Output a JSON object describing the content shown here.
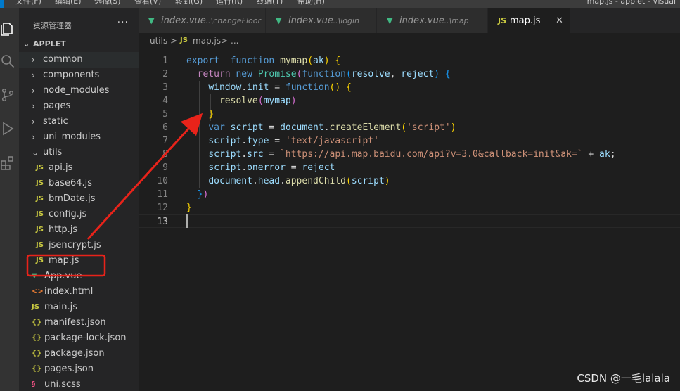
{
  "menu": {
    "items": [
      "文件(F)",
      "编辑(E)",
      "选择(S)",
      "查看(V)",
      "转到(G)",
      "运行(R)",
      "终端(T)",
      "帮助(H)"
    ],
    "window_title": "map.js - applet - Visual"
  },
  "activity_bar": {
    "icons": [
      "explorer-icon",
      "search-icon",
      "source-control-icon",
      "run-debug-icon",
      "extensions-icon"
    ]
  },
  "sidebar": {
    "title": "资源管理器",
    "more": "···",
    "section": "APPLET",
    "tree": [
      {
        "name": "common",
        "type": "folder",
        "expanded": false,
        "depth": 1
      },
      {
        "name": "components",
        "type": "folder",
        "expanded": false,
        "depth": 1
      },
      {
        "name": "node_modules",
        "type": "folder",
        "expanded": false,
        "depth": 1
      },
      {
        "name": "pages",
        "type": "folder",
        "expanded": false,
        "depth": 1
      },
      {
        "name": "static",
        "type": "folder",
        "expanded": false,
        "depth": 1
      },
      {
        "name": "uni_modules",
        "type": "folder",
        "expanded": false,
        "depth": 1
      },
      {
        "name": "utils",
        "type": "folder",
        "expanded": true,
        "depth": 1
      },
      {
        "name": "api.js",
        "type": "js",
        "depth": 2,
        "icon_text": "JS"
      },
      {
        "name": "base64.js",
        "type": "js",
        "depth": 2,
        "icon_text": "JS"
      },
      {
        "name": "bmDate.js",
        "type": "js",
        "depth": 2,
        "icon_text": "JS"
      },
      {
        "name": "config.js",
        "type": "js",
        "depth": 2,
        "icon_text": "JS"
      },
      {
        "name": "http.js",
        "type": "js",
        "depth": 2,
        "icon_text": "JS"
      },
      {
        "name": "jsencrypt.js",
        "type": "js",
        "depth": 2,
        "icon_text": "JS"
      },
      {
        "name": "map.js",
        "type": "js",
        "depth": 2,
        "icon_text": "JS"
      },
      {
        "name": "App.vue",
        "type": "vue",
        "depth": 1,
        "icon_text": "▼"
      },
      {
        "name": "index.html",
        "type": "html",
        "depth": 1,
        "icon_text": "<>"
      },
      {
        "name": "main.js",
        "type": "js",
        "depth": 1,
        "icon_text": "JS"
      },
      {
        "name": "manifest.json",
        "type": "json",
        "depth": 1,
        "icon_text": "{}"
      },
      {
        "name": "package-lock.json",
        "type": "json",
        "depth": 1,
        "icon_text": "{}"
      },
      {
        "name": "package.json",
        "type": "json",
        "depth": 1,
        "icon_text": "{}"
      },
      {
        "name": "pages.json",
        "type": "json",
        "depth": 1,
        "icon_text": "{}"
      },
      {
        "name": "uni.scss",
        "type": "scss",
        "depth": 1,
        "icon_text": "§"
      }
    ]
  },
  "tabs": [
    {
      "name": "index.vue",
      "dir": "...\\changeFloor",
      "type": "vue",
      "icon_text": "▼",
      "active": false
    },
    {
      "name": "index.vue",
      "dir": "...\\login",
      "type": "vue",
      "icon_text": "▼",
      "active": false
    },
    {
      "name": "index.vue",
      "dir": "...\\map",
      "type": "vue",
      "icon_text": "▼",
      "active": false
    },
    {
      "name": "map.js",
      "dir": "",
      "type": "js",
      "icon_text": "JS",
      "active": true,
      "close": "✕"
    }
  ],
  "breadcrumb": {
    "folder": "utils",
    "sep": ">",
    "file_icon": "JS",
    "file": "map.js",
    "more": "..."
  },
  "code": {
    "current_line": 13,
    "lines": [
      [
        [
          "kw",
          "export"
        ],
        [
          "",
          "  "
        ],
        [
          "kw",
          "function"
        ],
        [
          "",
          " "
        ],
        [
          "fn",
          "mymap"
        ],
        [
          "br1",
          "("
        ],
        [
          "param",
          "ak"
        ],
        [
          "br1",
          ")"
        ],
        [
          "",
          " "
        ],
        [
          "br1",
          "{"
        ]
      ],
      [
        [
          "",
          ""
        ],
        [
          "ctl",
          "return"
        ],
        [
          "",
          " "
        ],
        [
          "kw",
          "new"
        ],
        [
          "",
          " "
        ],
        [
          "cls",
          "Promise"
        ],
        [
          "br2",
          "("
        ],
        [
          "kw",
          "function"
        ],
        [
          "br3",
          "("
        ],
        [
          "param",
          "resolve"
        ],
        [
          "",
          ", "
        ],
        [
          "param",
          "reject"
        ],
        [
          "br3",
          ")"
        ],
        [
          "",
          " "
        ],
        [
          "br3",
          "{"
        ]
      ],
      [
        [
          "",
          ""
        ],
        [
          "param",
          "window"
        ],
        [
          "",
          "."
        ],
        [
          "param",
          "init"
        ],
        [
          "",
          " = "
        ],
        [
          "kw",
          "function"
        ],
        [
          "br1",
          "("
        ],
        [
          "br1",
          ")"
        ],
        [
          "",
          " "
        ],
        [
          "br1",
          "{"
        ]
      ],
      [
        [
          "",
          ""
        ],
        [
          "fn",
          "resolve"
        ],
        [
          "br2",
          "("
        ],
        [
          "param",
          "mymap"
        ],
        [
          "br2",
          ")"
        ]
      ],
      [
        [
          "",
          ""
        ],
        [
          "br1",
          "}"
        ]
      ],
      [
        [
          "",
          ""
        ],
        [
          "kw",
          "var"
        ],
        [
          "",
          " "
        ],
        [
          "param",
          "script"
        ],
        [
          "",
          " = "
        ],
        [
          "param",
          "document"
        ],
        [
          "",
          "."
        ],
        [
          "fn",
          "createElement"
        ],
        [
          "br1",
          "("
        ],
        [
          "str",
          "'script'"
        ],
        [
          "br1",
          ")"
        ]
      ],
      [
        [
          "",
          ""
        ],
        [
          "param",
          "script"
        ],
        [
          "",
          "."
        ],
        [
          "param",
          "type"
        ],
        [
          "",
          " = "
        ],
        [
          "str",
          "'text/javascript'"
        ]
      ],
      [
        [
          "",
          ""
        ],
        [
          "param",
          "script"
        ],
        [
          "",
          "."
        ],
        [
          "param",
          "src"
        ],
        [
          "",
          " = "
        ],
        [
          "str",
          "`"
        ],
        [
          "url",
          "https://api.map.baidu.com/api?v=3.0&callback=init&ak="
        ],
        [
          "str",
          "`"
        ],
        [
          "",
          " + "
        ],
        [
          "param",
          "ak"
        ],
        [
          "",
          ";"
        ]
      ],
      [
        [
          "",
          ""
        ],
        [
          "param",
          "script"
        ],
        [
          "",
          "."
        ],
        [
          "param",
          "onerror"
        ],
        [
          "",
          " = "
        ],
        [
          "param",
          "reject"
        ]
      ],
      [
        [
          "",
          ""
        ],
        [
          "param",
          "document"
        ],
        [
          "",
          "."
        ],
        [
          "param",
          "head"
        ],
        [
          "",
          "."
        ],
        [
          "fn",
          "appendChild"
        ],
        [
          "br1",
          "("
        ],
        [
          "param",
          "script"
        ],
        [
          "br1",
          ")"
        ]
      ],
      [
        [
          "",
          ""
        ],
        [
          "br3",
          "}"
        ],
        [
          "br2",
          ")"
        ]
      ],
      [
        [
          "",
          ""
        ],
        [
          "br1",
          "}"
        ]
      ],
      [
        [
          "",
          ""
        ]
      ]
    ]
  },
  "watermark": "CSDN @一毛lalala",
  "annotation": {
    "color": "#e8231a",
    "label": "highlight-map-js"
  }
}
